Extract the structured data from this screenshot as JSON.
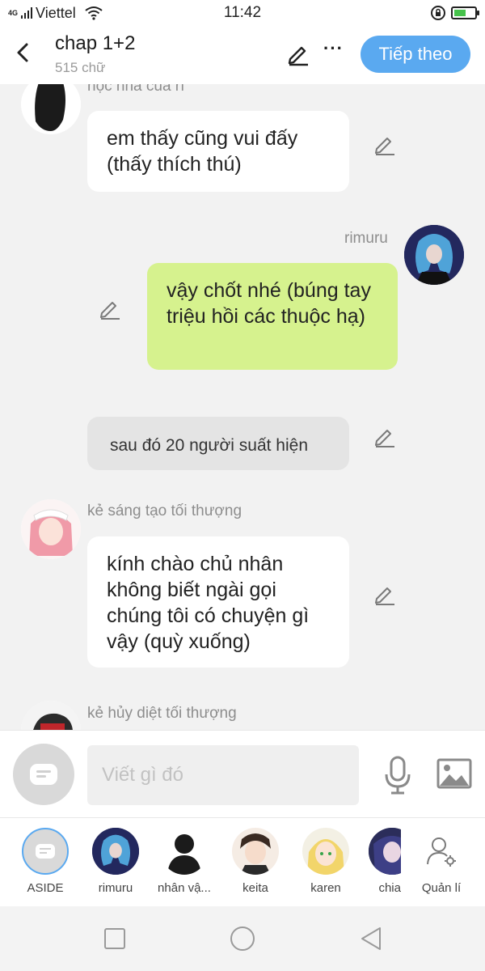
{
  "status": {
    "carrier": "Viettel",
    "network": "4G",
    "time": "11:42"
  },
  "header": {
    "title": "chap 1+2",
    "subtitle": "515 chữ",
    "next_label": "Tiếp theo",
    "more_label": "···"
  },
  "messages": [
    {
      "side": "left",
      "name": "hộc nha của rí",
      "text": "em thấy cũng vui đấy (thấy thích thú)"
    },
    {
      "side": "right",
      "name": "rimuru",
      "text": "vậy chốt nhé (búng tay triệu hồi các thuộc hạ)"
    },
    {
      "side": "aside",
      "text": "sau đó 20 người suất hiện"
    },
    {
      "side": "left",
      "name": "kẻ sáng tạo tối thượng",
      "text": "kính chào chủ nhân không biết ngài gọi chúng tôi có chuyện gì vậy (quỳ xuống)"
    },
    {
      "side": "left",
      "name": "kẻ hủy diệt tối thượng",
      "text": ""
    }
  ],
  "input": {
    "placeholder": "Viết gì đó"
  },
  "characters": [
    {
      "name": "ASIDE",
      "icon": "aside-icon"
    },
    {
      "name": "rimuru",
      "icon": "rimuru-avatar"
    },
    {
      "name": "nhân vậ...",
      "icon": "silhouette-avatar"
    },
    {
      "name": "keita",
      "icon": "keita-avatar"
    },
    {
      "name": "karen",
      "icon": "karen-avatar"
    },
    {
      "name": "chia",
      "icon": "chia-avatar"
    },
    {
      "name": "Quản lí",
      "icon": "manage-user-icon"
    }
  ],
  "colors": {
    "accent": "#5aa9f0",
    "right_bubble": "#d6f28e",
    "aside_bubble": "#e4e4e4",
    "background": "#f2f2f2"
  }
}
